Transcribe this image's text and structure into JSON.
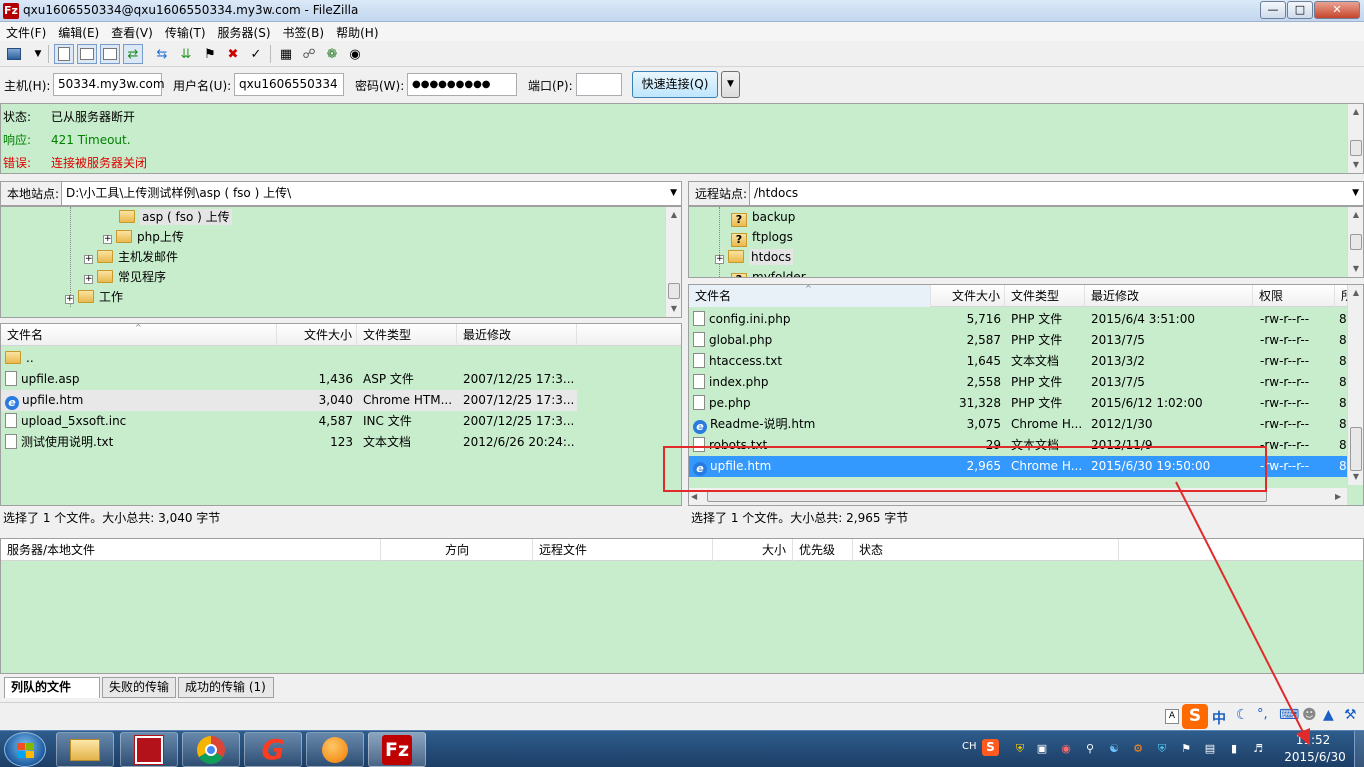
{
  "window": {
    "title": "qxu1606550334@qxu1606550334.my3w.com - FileZilla",
    "app_icon": "Fz",
    "controls": [
      "minimize-icon",
      "maximize-icon",
      "close-icon"
    ]
  },
  "menu": [
    "文件(F)",
    "编辑(E)",
    "查看(V)",
    "传输(T)",
    "服务器(S)",
    "书签(B)",
    "帮助(H)"
  ],
  "quickconnect": {
    "host_label": "主机(H):",
    "host_value": "50334.my3w.com",
    "user_label": "用户名(U):",
    "user_value": "qxu1606550334",
    "pass_label": "密码(W):",
    "pass_value": "●●●●●●●●●",
    "port_label": "端口(P):",
    "port_value": "",
    "button": "快速连接(Q)",
    "dropdown": "▼"
  },
  "log": [
    {
      "label": "状态:",
      "text": "已从服务器断开",
      "color": "#000000"
    },
    {
      "label": "响应:",
      "text": "421 Timeout.",
      "color": "#008000"
    },
    {
      "label": "错误:",
      "text": "连接被服务器关闭",
      "color": "#e00000"
    }
  ],
  "local": {
    "site_label": "本地站点:",
    "path": "D:\\小工具\\上传测试样例\\asp ( fso ) 上传\\",
    "tree": [
      {
        "label": "asp ( fso ) 上传",
        "selected": true,
        "expander": ""
      },
      {
        "label": "php上传",
        "expander": "+"
      },
      {
        "label": "主机发邮件",
        "expander": "+"
      },
      {
        "label": "常见程序",
        "expander": "+"
      },
      {
        "label": "工作",
        "expander": "+"
      }
    ],
    "columns": [
      "文件名",
      "文件大小",
      "文件类型",
      "最近修改"
    ],
    "files": [
      {
        "name": "..",
        "size": "",
        "type": "",
        "modified": "",
        "icon": "folder-icon"
      },
      {
        "name": "upfile.asp",
        "size": "1,436",
        "type": "ASP 文件",
        "modified": "2007/12/25 17:3...",
        "icon": "file-icon"
      },
      {
        "name": "upfile.htm",
        "size": "3,040",
        "type": "Chrome HTM...",
        "modified": "2007/12/25 17:3...",
        "icon": "ie-icon",
        "selected": true
      },
      {
        "name": "upload_5xsoft.inc",
        "size": "4,587",
        "type": "INC 文件",
        "modified": "2007/12/25 17:3...",
        "icon": "file-icon"
      },
      {
        "name": "测试使用说明.txt",
        "size": "123",
        "type": "文本文档",
        "modified": "2012/6/26 20:24:...",
        "icon": "file-icon"
      }
    ],
    "status": "选择了 1 个文件。大小总共: 3,040 字节"
  },
  "remote": {
    "site_label": "远程站点:",
    "path": "/htdocs",
    "tree": [
      {
        "label": "backup",
        "expander": ""
      },
      {
        "label": "ftplogs",
        "expander": ""
      },
      {
        "label": "htdocs",
        "expander": "+",
        "selected": true
      },
      {
        "label": "myfolder",
        "expander": ""
      }
    ],
    "columns": [
      "文件名",
      "文件大小",
      "文件类型",
      "最近修改",
      "权限",
      "所"
    ],
    "files": [
      {
        "name": "config.ini.php",
        "size": "5,716",
        "type": "PHP 文件",
        "modified": "2015/6/4 3:51:00",
        "perm": "-rw-r--r--",
        "owner": "8",
        "icon": "file-icon"
      },
      {
        "name": "global.php",
        "size": "2,587",
        "type": "PHP 文件",
        "modified": "2013/7/5",
        "perm": "-rw-r--r--",
        "owner": "8",
        "icon": "file-icon"
      },
      {
        "name": "htaccess.txt",
        "size": "1,645",
        "type": "文本文档",
        "modified": "2013/3/2",
        "perm": "-rw-r--r--",
        "owner": "8",
        "icon": "file-icon"
      },
      {
        "name": "index.php",
        "size": "2,558",
        "type": "PHP 文件",
        "modified": "2013/7/5",
        "perm": "-rw-r--r--",
        "owner": "8",
        "icon": "file-icon"
      },
      {
        "name": "pe.php",
        "size": "31,328",
        "type": "PHP 文件",
        "modified": "2015/6/12 1:02:00",
        "perm": "-rw-r--r--",
        "owner": "8",
        "icon": "file-icon"
      },
      {
        "name": "Readme-说明.htm",
        "size": "3,075",
        "type": "Chrome H...",
        "modified": "2012/1/30",
        "perm": "-rw-r--r--",
        "owner": "8",
        "icon": "ie-icon"
      },
      {
        "name": "robots.txt",
        "size": "29",
        "type": "文本文档",
        "modified": "2012/11/9",
        "perm": "-rw-r--r--",
        "owner": "8",
        "icon": "file-icon"
      },
      {
        "name": "upfile.htm",
        "size": "2,965",
        "type": "Chrome H...",
        "modified": "2015/6/30 19:50:00",
        "perm": "-rw-r--r--",
        "owner": "8",
        "icon": "ie-icon",
        "selected": true
      }
    ],
    "status": "选择了 1 个文件。大小总共: 2,965 字节"
  },
  "queue": {
    "columns": [
      "服务器/本地文件",
      "方向",
      "远程文件",
      "大小",
      "优先级",
      "状态"
    ],
    "tabs": [
      "列队的文件",
      "失败的传输",
      "成功的传输 (1)"
    ]
  },
  "ime_bar": {
    "mode": "中"
  },
  "taskbar": {
    "apps": [
      "explorer-icon",
      "app-red-icon",
      "chrome-icon",
      "sogou-app-icon",
      "orange-icon",
      "filezilla-icon"
    ],
    "lang": "CH",
    "time": "11:52",
    "date": "2015/6/30"
  },
  "colors": {
    "pane_bg": "#c7edcc",
    "selection": "#3399ff",
    "annotation": "#e12b2b"
  }
}
